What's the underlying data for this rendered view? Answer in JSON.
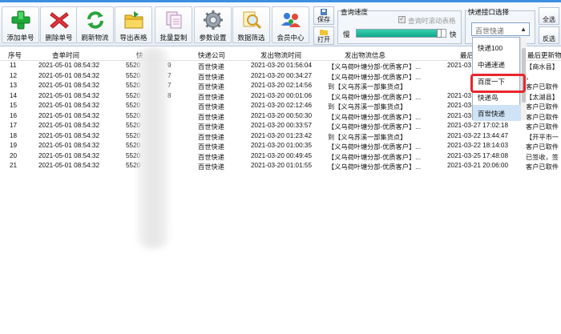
{
  "toolbar": {
    "buttons": [
      {
        "label": "添加单号",
        "icon": "plus-icon"
      },
      {
        "label": "删除单号",
        "icon": "delete-x-icon"
      },
      {
        "label": "刷新物流",
        "icon": "refresh-icon"
      },
      {
        "label": "导出表格",
        "icon": "folder-icon"
      },
      {
        "label": "批量复制",
        "icon": "copy-icon"
      },
      {
        "label": "参数设置",
        "icon": "gear-icon"
      },
      {
        "label": "数据筛选",
        "icon": "magnifier-icon"
      },
      {
        "label": "会员中心",
        "icon": "members-icon"
      }
    ],
    "save_label": "保存",
    "open_label": "打开",
    "speed": {
      "title": "查询速度",
      "autoscroll_label": "查询时滚动表格",
      "slow": "慢",
      "fast": "快",
      "level": 0.93
    },
    "api": {
      "title": "快递接口选择",
      "selected": "百世快递"
    },
    "select_all_label": "全选",
    "invert_label": "反选"
  },
  "dropdown": {
    "items": [
      "快递100",
      "中通速递",
      "百度一下",
      "快递鸟",
      "百世快递"
    ],
    "highlighted_index": 4,
    "boxed_index": 2
  },
  "table": {
    "headers": [
      "序号",
      "查单时间",
      "快",
      "快递公司",
      "发出物流时间",
      "发出物流信息",
      "最后",
      "最后更新物"
    ],
    "rows": [
      [
        "11",
        "2021-05-01 08:54:32",
        "5520",
        "9",
        "百世快递",
        "2021-03-20 01:56:04",
        "【义乌荷叶塘分部-优质客户】...",
        "2021-03",
        "【商水县】"
      ],
      [
        "12",
        "2021-05-01 08:54:32",
        "5520",
        "7",
        "百世快递",
        "2021-03-20 00:34:27",
        "【义乌荷叶塘分部-优质客户】...",
        "",
        "，"
      ],
      [
        "13",
        "2021-05-01 08:54:32",
        "5520",
        "7",
        "百世快递",
        "2021-03-20 02:14:56",
        "到【义乌苏溪一部集货点】",
        "",
        "客户已取件"
      ],
      [
        "14",
        "2021-05-01 08:54:32",
        "5520",
        "8",
        "百世快递",
        "2021-03-20 00:01:06",
        "【义乌荷叶塘分部-优质客户】...",
        "2021-03",
        "【太湖县】"
      ],
      [
        "15",
        "2021-05-01 08:54:32",
        "5520",
        "",
        "百世快递",
        "2021-03-20 02:12:46",
        "到【义乌苏溪一部集货点】",
        "2021-03-27 16:06:40",
        "客户已取件"
      ],
      [
        "16",
        "2021-05-01 08:54:32",
        "5520",
        "",
        "百世快递",
        "2021-03-20 00:50:30",
        "【义乌荷叶塘分部-优质客户】...",
        "2021-03-25 11:31:22",
        "客户已取件"
      ],
      [
        "17",
        "2021-05-01 08:54:32",
        "5520",
        "",
        "百世快递",
        "2021-03-20 00:33:57",
        "【义乌荷叶塘分部-优质客户】...",
        "2021-03-27 17:02:18",
        "客户已取件"
      ],
      [
        "18",
        "2021-05-01 08:54:32",
        "5520",
        "",
        "百世快递",
        "2021-03-20 01:23:42",
        "到【义乌苏溪一部集货点】",
        "2021-03-22 13:44:47",
        "【开平市一"
      ],
      [
        "19",
        "2021-05-01 08:54:32",
        "5520",
        "",
        "百世快递",
        "2021-03-20 01:00:35",
        "【义乌荷叶塘分部-优质客户】...",
        "2021-03-22 18:14:03",
        "客户已取件"
      ],
      [
        "20",
        "2021-05-01 08:54:32",
        "5520",
        "",
        "百世快递",
        "2021-03-20 00:49:45",
        "【义乌荷叶塘分部-优质客户】...",
        "2021-03-25 17:48:08",
        "已签收，签"
      ],
      [
        "21",
        "2021-05-01 08:54:32",
        "5520",
        "",
        "百世快递",
        "2021-03-20 01:01:55",
        "【义乌荷叶塘分部-优质客户】...",
        "2021-03-21 20:06:00",
        "客户已取件"
      ]
    ]
  },
  "colors": {
    "topline": "#3d8fe0",
    "progress": "#10a888",
    "highlight_box": "#e8262c",
    "dropdown_highlight": "#cfe3f7"
  }
}
